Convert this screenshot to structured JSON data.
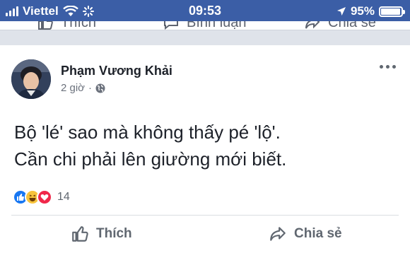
{
  "status_bar": {
    "carrier": "Viettel",
    "time": "09:53",
    "battery_text": "95%",
    "battery_level": 0.95,
    "icons": [
      "signal-icon",
      "wifi-icon",
      "loading-icon",
      "location-arrow-icon",
      "battery-icon"
    ]
  },
  "previous_post_actions": {
    "like_label": "Thích",
    "comment_label": "Bình luận",
    "share_label": "Chia sẻ"
  },
  "post": {
    "author": "Phạm Vương Khải",
    "time": "2 giờ",
    "separator": "·",
    "privacy_icon": "globe-icon",
    "lines": [
      "Bộ 'lé' sao mà không thấy pé 'lộ'.",
      "Cần chi phải lên giường mới biết."
    ],
    "reactions": {
      "types": [
        "like",
        "haha",
        "love"
      ],
      "count": "14"
    },
    "actions": {
      "like_label": "Thích",
      "share_label": "Chia sẻ"
    }
  },
  "colors": {
    "status_bar_bg": "#3b5ea6",
    "like_blue": "#1877f2",
    "haha_yellow": "#f7c33b",
    "love_red": "#f0284a",
    "text_dark": "#1d2129",
    "text_grey": "#606770"
  }
}
